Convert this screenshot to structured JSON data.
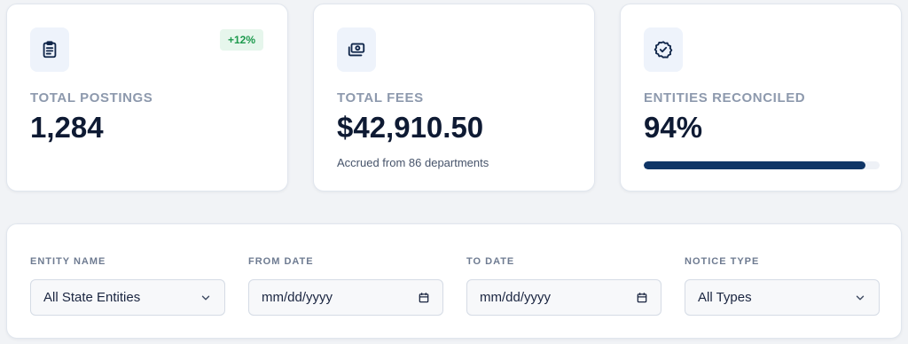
{
  "stats": [
    {
      "label": "TOTAL POSTINGS",
      "value": "1,284",
      "badge": "+12%",
      "icon": "clipboard-icon"
    },
    {
      "label": "TOTAL FEES",
      "value": "$42,910.50",
      "subtext": "Accrued from 86 departments",
      "icon": "money-icon"
    },
    {
      "label": "ENTITIES RECONCILED",
      "value": "94%",
      "progress": 0.94,
      "icon": "badge-check-icon"
    }
  ],
  "filters": {
    "entity": {
      "label": "ENTITY NAME",
      "value": "All State Entities"
    },
    "from": {
      "label": "FROM DATE",
      "placeholder": "mm/dd/yyyy"
    },
    "to": {
      "label": "TO DATE",
      "placeholder": "mm/dd/yyyy"
    },
    "type": {
      "label": "NOTICE TYPE",
      "value": "All Types"
    }
  },
  "colors": {
    "accent": "#0f3566",
    "badge_bg": "#e6f6ec",
    "badge_text": "#1d9a4d",
    "label": "#8d99ad"
  }
}
